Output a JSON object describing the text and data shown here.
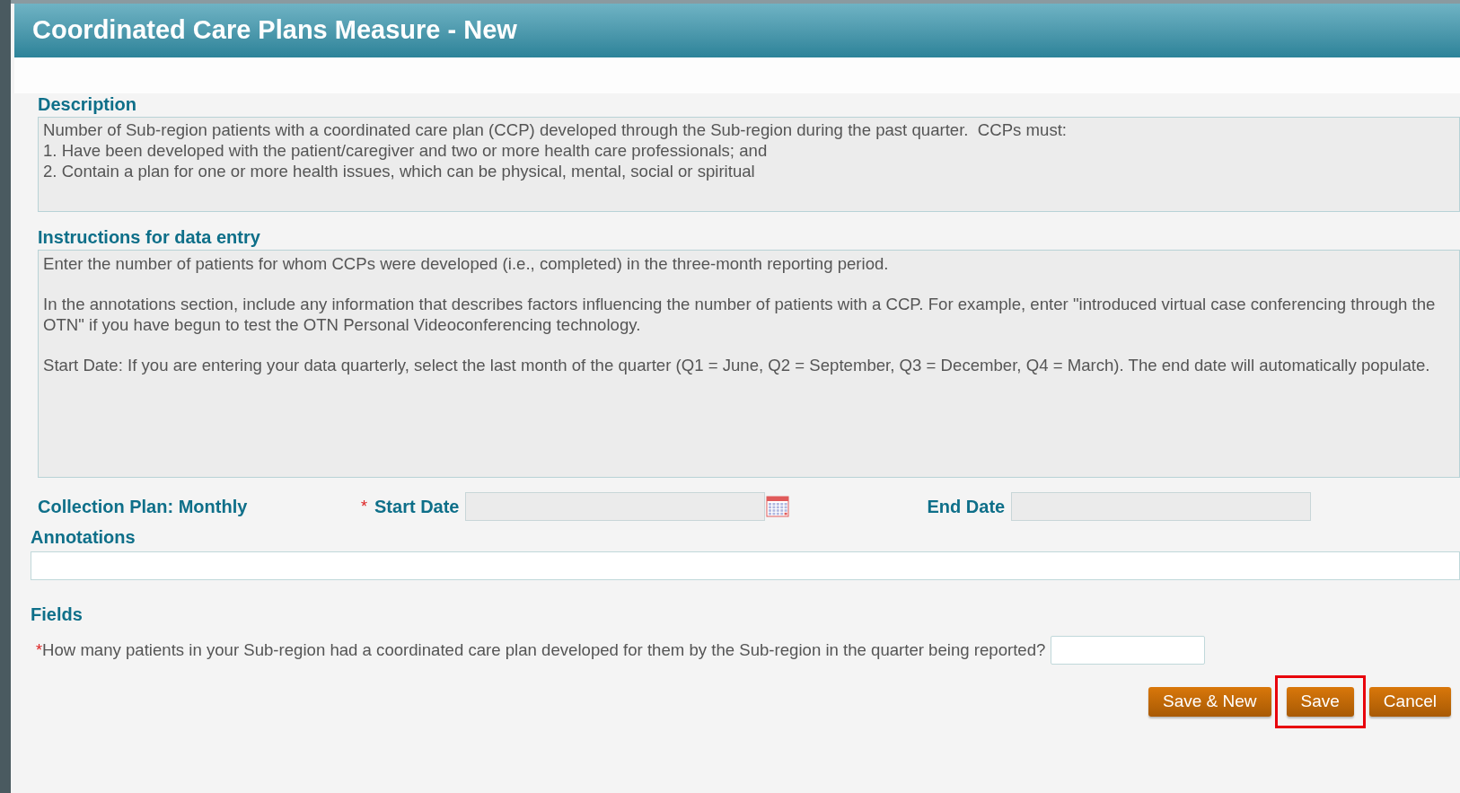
{
  "window": {
    "title": "Coordinated Care Plans Measure - New"
  },
  "description": {
    "label": "Description",
    "lines": [
      "Number of Sub-region patients with a coordinated care plan (CCP) developed through the Sub-region during the past quarter.  CCPs must:",
      "1. Have been developed with the patient/caregiver and two or more health care professionals; and",
      "2. Contain a plan for one or more health issues, which can be physical, mental, social or spiritual"
    ]
  },
  "instructions": {
    "label": "Instructions for data entry",
    "paragraphs": [
      "Enter the number of patients for whom CCPs were developed (i.e., completed) in the three-month reporting period.",
      "In the annotations section, include any information that describes factors influencing the number of patients with a CCP. For example, enter \"introduced virtual case conferencing through the OTN\" if you have begun to test the OTN Personal Videoconferencing technology.",
      "Start Date: If you are entering your data quarterly, select the last month of the quarter (Q1 = June, Q2 = September, Q3 =  December, Q4 = March). The end date will automatically populate."
    ]
  },
  "collection_plan": "Collection Plan: Monthly",
  "start_date": {
    "required_mark": "*",
    "label": "Start Date"
  },
  "end_date": {
    "label": "End Date"
  },
  "annotations": {
    "label": "Annotations"
  },
  "fields": {
    "label": "Fields",
    "questions": [
      {
        "required_mark": "*",
        "text": "How many patients in your Sub-region had a coordinated care plan developed for them by the Sub-region in the quarter being reported?"
      }
    ]
  },
  "buttons": [
    {
      "label": "Save & New",
      "highlighted": false
    },
    {
      "label": "Save",
      "highlighted": true
    },
    {
      "label": "Cancel",
      "highlighted": false
    }
  ]
}
